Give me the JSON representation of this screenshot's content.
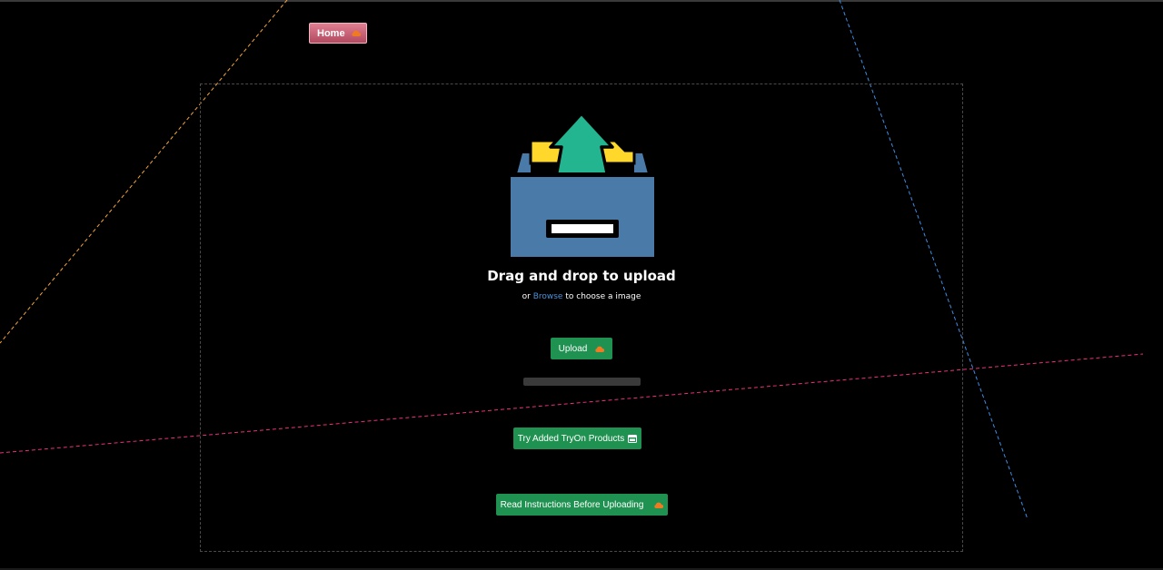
{
  "header": {
    "home_label": "Home"
  },
  "upload_area": {
    "title": "Drag and drop to upload",
    "subtitle_prefix": "or",
    "browse_link": "Browse",
    "subtitle_suffix": "to choose a image",
    "upload_button_label": "Upload",
    "upload_progress": 0
  },
  "actions": {
    "tryon_label": "Try Added TryOn Products",
    "instructions_label": "Read Instructions Before Uploading"
  },
  "icons": {
    "home": "cloud-icon",
    "upload": "cloud-icon",
    "tryon": "window-icon",
    "instructions": "cloud-icon",
    "illustration": "upload-tray-icon"
  },
  "colors": {
    "background": "#000000",
    "button_green": "#1f9150",
    "home_button": "#c85a70",
    "link_blue": "#4a90d9",
    "cloud_orange": "#f07a22",
    "tray_blue": "#4a7aa8",
    "paper_yellow": "#ffd82b",
    "arrow_teal": "#22b58f"
  }
}
